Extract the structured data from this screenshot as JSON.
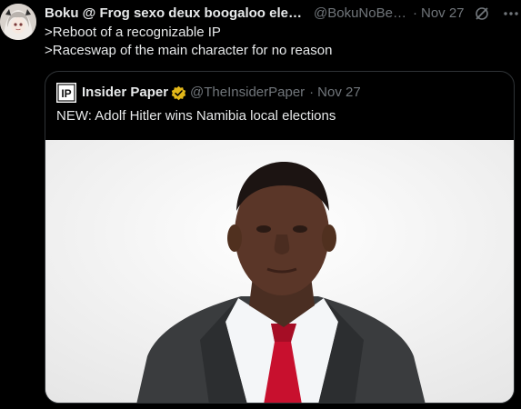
{
  "tweet": {
    "display_name": "Boku @ Frog sexo deux boogaloo elect...",
    "handle": "@BokuNoBee...",
    "separator": "·",
    "date": "Nov 27",
    "lines": [
      ">Reboot of a recognizable IP",
      ">Raceswap of the main character for no reason"
    ]
  },
  "quote": {
    "logo_text": "IP",
    "name": "Insider Paper",
    "handle": "@TheInsiderPaper",
    "separator": "·",
    "date": "Nov 27",
    "text": "NEW: Adolf Hitler wins Namibia local elections"
  },
  "icons": {
    "grok": "grok-icon",
    "more": "more-icon",
    "verified": "verified-badge-icon"
  },
  "colors": {
    "background": "#000000",
    "text": "#e7e9ea",
    "secondary_text": "#71767b",
    "border": "#2f3336",
    "verified_gold": "#e2b719",
    "tie_red": "#c8102e"
  }
}
